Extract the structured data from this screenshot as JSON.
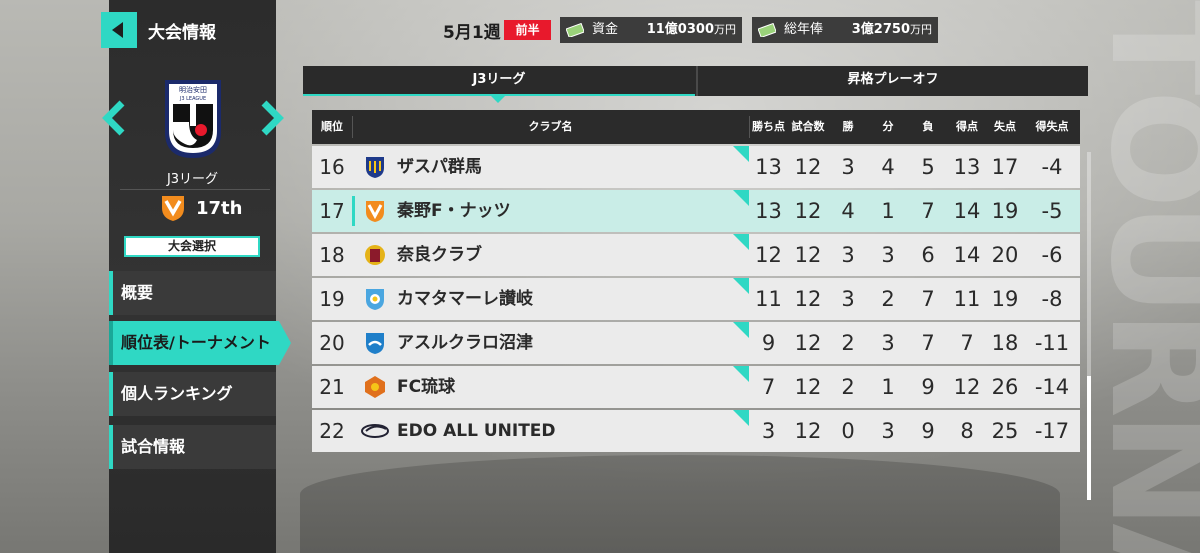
{
  "header": {
    "title": "大会情報",
    "week": "5月1週",
    "half_badge": "前半",
    "funds_label": "資金",
    "funds_value": "11億0300",
    "funds_unit": "万円",
    "salary_label": "総年俸",
    "salary_value": "3億2750",
    "salary_unit": "万円"
  },
  "sidebar": {
    "league_name": "J3リーグ",
    "team_rank": "17th",
    "select_button": "大会選択",
    "logo_text_top": "明治安田",
    "logo_text_sub": "J3 LEAGUE",
    "menu": [
      {
        "label": "概要"
      },
      {
        "label": "順位表/トーナメント"
      },
      {
        "label": "個人ランキング"
      },
      {
        "label": "試合情報"
      }
    ]
  },
  "tabs": [
    {
      "label": "J3リーグ"
    },
    {
      "label": "昇格プレーオフ"
    }
  ],
  "standings": {
    "headers": [
      "順位",
      "クラブ名",
      "勝ち点",
      "試合数",
      "勝",
      "分",
      "負",
      "得点",
      "失点",
      "得失点"
    ],
    "rows": [
      {
        "rank": "16",
        "club": "ザスパ群馬",
        "pts": "13",
        "played": "12",
        "w": "3",
        "d": "4",
        "l": "5",
        "gf": "13",
        "ga": "17",
        "gd": "-4"
      },
      {
        "rank": "17",
        "club": "秦野F・ナッツ",
        "pts": "13",
        "played": "12",
        "w": "4",
        "d": "1",
        "l": "7",
        "gf": "14",
        "ga": "19",
        "gd": "-5"
      },
      {
        "rank": "18",
        "club": "奈良クラブ",
        "pts": "12",
        "played": "12",
        "w": "3",
        "d": "3",
        "l": "6",
        "gf": "14",
        "ga": "20",
        "gd": "-6"
      },
      {
        "rank": "19",
        "club": "カマタマーレ讃岐",
        "pts": "11",
        "played": "12",
        "w": "3",
        "d": "2",
        "l": "7",
        "gf": "11",
        "ga": "19",
        "gd": "-8"
      },
      {
        "rank": "20",
        "club": "アスルクラロ沼津",
        "pts": "9",
        "played": "12",
        "w": "2",
        "d": "3",
        "l": "7",
        "gf": "7",
        "ga": "18",
        "gd": "-11"
      },
      {
        "rank": "21",
        "club": "FC琉球",
        "pts": "7",
        "played": "12",
        "w": "2",
        "d": "1",
        "l": "9",
        "gf": "12",
        "ga": "26",
        "gd": "-14"
      },
      {
        "rank": "22",
        "club": "EDO ALL UNITED",
        "pts": "3",
        "played": "12",
        "w": "0",
        "d": "3",
        "l": "9",
        "gf": "8",
        "ga": "25",
        "gd": "-17"
      }
    ]
  },
  "watermark": "TOURNA",
  "colors": {
    "accent": "#2fd8c4",
    "badge_red": "#e8192c",
    "row_bg": "#ebebeb",
    "row_highlight": "#c9ede7"
  }
}
